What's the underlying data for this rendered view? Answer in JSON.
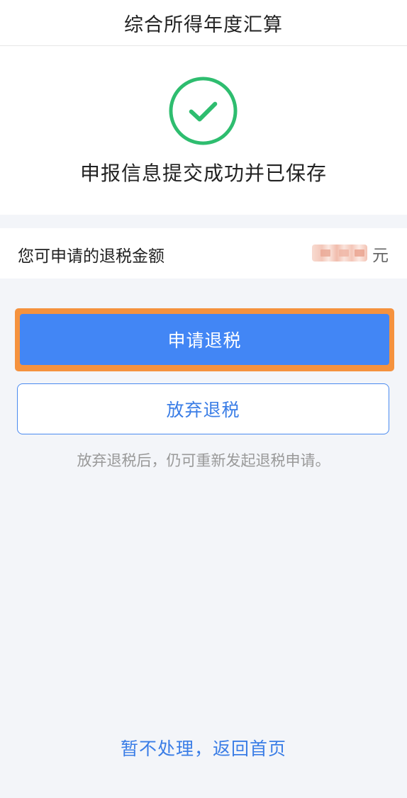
{
  "header": {
    "title": "综合所得年度汇算"
  },
  "result": {
    "icon": "check-circle-icon",
    "status_color": "#2ebd6f",
    "message": "申报信息提交成功并已保存"
  },
  "refund": {
    "label": "您可申请的退税金额",
    "unit": "元"
  },
  "actions": {
    "apply_label": "申请退税",
    "apply_color": "#4286f5",
    "highlight_color": "#f5923e",
    "waive_label": "放弃退税",
    "hint": "放弃退税后，仍可重新发起退税申请。",
    "back_home_label": "暂不处理，返回首页"
  }
}
